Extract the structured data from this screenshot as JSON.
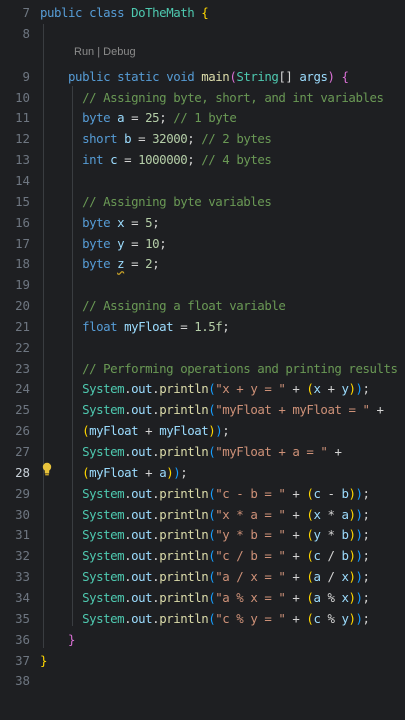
{
  "editor": {
    "language": "java",
    "active_line": 28,
    "codelens": "Run | Debug",
    "lines": [
      {
        "n": "7",
        "parts": [
          [
            "kw",
            "public "
          ],
          [
            "kw",
            "class "
          ],
          [
            "ty",
            "DoTheMath"
          ],
          [
            "pn",
            " "
          ],
          [
            "br1",
            "{"
          ]
        ]
      },
      {
        "n": "8",
        "parts": []
      },
      {
        "n": "9",
        "parts": [
          [
            "pn",
            "    "
          ],
          [
            "kw",
            "public "
          ],
          [
            "kw",
            "static "
          ],
          [
            "kw",
            "void "
          ],
          [
            "fn",
            "main"
          ],
          [
            "br2",
            "("
          ],
          [
            "ty",
            "String"
          ],
          [
            "pn",
            "[] "
          ],
          [
            "var",
            "args"
          ],
          [
            "br2",
            ")"
          ],
          [
            "pn",
            " "
          ],
          [
            "br2",
            "{"
          ]
        ]
      },
      {
        "n": "10",
        "parts": [
          [
            "pn",
            "      "
          ],
          [
            "cm",
            "// Assigning byte, short, and int variables"
          ]
        ]
      },
      {
        "n": "11",
        "parts": [
          [
            "pn",
            "      "
          ],
          [
            "kw",
            "byte "
          ],
          [
            "var",
            "a"
          ],
          [
            "pn",
            " = "
          ],
          [
            "num",
            "25"
          ],
          [
            "pn",
            "; "
          ],
          [
            "cm",
            "// 1 byte"
          ]
        ]
      },
      {
        "n": "12",
        "parts": [
          [
            "pn",
            "      "
          ],
          [
            "kw",
            "short "
          ],
          [
            "var",
            "b"
          ],
          [
            "pn",
            " = "
          ],
          [
            "num",
            "32000"
          ],
          [
            "pn",
            "; "
          ],
          [
            "cm",
            "// 2 bytes"
          ]
        ]
      },
      {
        "n": "13",
        "parts": [
          [
            "pn",
            "      "
          ],
          [
            "kw",
            "int "
          ],
          [
            "var",
            "c"
          ],
          [
            "pn",
            " = "
          ],
          [
            "num",
            "1000000"
          ],
          [
            "pn",
            "; "
          ],
          [
            "cm",
            "// 4 bytes"
          ]
        ]
      },
      {
        "n": "14",
        "parts": []
      },
      {
        "n": "15",
        "parts": [
          [
            "pn",
            "      "
          ],
          [
            "cm",
            "// Assigning byte variables"
          ]
        ]
      },
      {
        "n": "16",
        "parts": [
          [
            "pn",
            "      "
          ],
          [
            "kw",
            "byte "
          ],
          [
            "var",
            "x"
          ],
          [
            "pn",
            " = "
          ],
          [
            "num",
            "5"
          ],
          [
            "pn",
            ";"
          ]
        ]
      },
      {
        "n": "17",
        "parts": [
          [
            "pn",
            "      "
          ],
          [
            "kw",
            "byte "
          ],
          [
            "var",
            "y"
          ],
          [
            "pn",
            " = "
          ],
          [
            "num",
            "10"
          ],
          [
            "pn",
            ";"
          ]
        ]
      },
      {
        "n": "18",
        "parts": [
          [
            "pn",
            "      "
          ],
          [
            "kw",
            "byte "
          ],
          [
            "squig",
            "z"
          ],
          [
            "pn",
            " = "
          ],
          [
            "num",
            "2"
          ],
          [
            "pn",
            ";"
          ]
        ]
      },
      {
        "n": "19",
        "parts": []
      },
      {
        "n": "20",
        "parts": [
          [
            "pn",
            "      "
          ],
          [
            "cm",
            "// Assigning a float variable"
          ]
        ]
      },
      {
        "n": "21",
        "parts": [
          [
            "pn",
            "      "
          ],
          [
            "kw",
            "float "
          ],
          [
            "var",
            "myFloat"
          ],
          [
            "pn",
            " = "
          ],
          [
            "num",
            "1.5f"
          ],
          [
            "pn",
            ";"
          ]
        ]
      },
      {
        "n": "22",
        "parts": []
      },
      {
        "n": "23",
        "parts": [
          [
            "pn",
            "      "
          ],
          [
            "cm",
            "// Performing operations and printing results"
          ]
        ]
      },
      {
        "n": "24",
        "parts": [
          [
            "pn",
            "      "
          ],
          [
            "ty",
            "System"
          ],
          [
            "pn",
            "."
          ],
          [
            "var",
            "out"
          ],
          [
            "pn",
            "."
          ],
          [
            "fn",
            "println"
          ],
          [
            "br3",
            "("
          ],
          [
            "str",
            "\"x + y = \""
          ],
          [
            "pn",
            " + "
          ],
          [
            "br1",
            "("
          ],
          [
            "var",
            "x"
          ],
          [
            "pn",
            " + "
          ],
          [
            "var",
            "y"
          ],
          [
            "br1",
            ")"
          ],
          [
            "br3",
            ")"
          ],
          [
            "pn",
            ";"
          ]
        ]
      },
      {
        "n": "25",
        "parts": [
          [
            "pn",
            "      "
          ],
          [
            "ty",
            "System"
          ],
          [
            "pn",
            "."
          ],
          [
            "var",
            "out"
          ],
          [
            "pn",
            "."
          ],
          [
            "fn",
            "println"
          ],
          [
            "br3",
            "("
          ],
          [
            "str",
            "\"myFloat + myFloat = \""
          ],
          [
            "pn",
            " +"
          ]
        ]
      },
      {
        "n": "26",
        "parts": [
          [
            "pn",
            "      "
          ],
          [
            "br1",
            "("
          ],
          [
            "var",
            "myFloat"
          ],
          [
            "pn",
            " + "
          ],
          [
            "var",
            "myFloat"
          ],
          [
            "br1",
            ")"
          ],
          [
            "br3",
            ")"
          ],
          [
            "pn",
            ";"
          ]
        ]
      },
      {
        "n": "27",
        "parts": [
          [
            "pn",
            "      "
          ],
          [
            "ty",
            "System"
          ],
          [
            "pn",
            "."
          ],
          [
            "var",
            "out"
          ],
          [
            "pn",
            "."
          ],
          [
            "fn",
            "println"
          ],
          [
            "br3",
            "("
          ],
          [
            "str",
            "\"myFloat + a = \""
          ],
          [
            "pn",
            " +"
          ]
        ]
      },
      {
        "n": "28",
        "parts": [
          [
            "pn",
            "      "
          ],
          [
            "br1",
            "("
          ],
          [
            "var",
            "myFloat"
          ],
          [
            "pn",
            " + "
          ],
          [
            "var",
            "a"
          ],
          [
            "br1",
            ")"
          ],
          [
            "br3",
            ")"
          ],
          [
            "pn",
            ";"
          ]
        ]
      },
      {
        "n": "29",
        "parts": [
          [
            "pn",
            "      "
          ],
          [
            "ty",
            "System"
          ],
          [
            "pn",
            "."
          ],
          [
            "var",
            "out"
          ],
          [
            "pn",
            "."
          ],
          [
            "fn",
            "println"
          ],
          [
            "br3",
            "("
          ],
          [
            "str",
            "\"c - b = \""
          ],
          [
            "pn",
            " + "
          ],
          [
            "br1",
            "("
          ],
          [
            "var",
            "c"
          ],
          [
            "pn",
            " - "
          ],
          [
            "var",
            "b"
          ],
          [
            "br1",
            ")"
          ],
          [
            "br3",
            ")"
          ],
          [
            "pn",
            ";"
          ]
        ]
      },
      {
        "n": "30",
        "parts": [
          [
            "pn",
            "      "
          ],
          [
            "ty",
            "System"
          ],
          [
            "pn",
            "."
          ],
          [
            "var",
            "out"
          ],
          [
            "pn",
            "."
          ],
          [
            "fn",
            "println"
          ],
          [
            "br3",
            "("
          ],
          [
            "str",
            "\"x * a = \""
          ],
          [
            "pn",
            " + "
          ],
          [
            "br1",
            "("
          ],
          [
            "var",
            "x"
          ],
          [
            "pn",
            " * "
          ],
          [
            "var",
            "a"
          ],
          [
            "br1",
            ")"
          ],
          [
            "br3",
            ")"
          ],
          [
            "pn",
            ";"
          ]
        ]
      },
      {
        "n": "31",
        "parts": [
          [
            "pn",
            "      "
          ],
          [
            "ty",
            "System"
          ],
          [
            "pn",
            "."
          ],
          [
            "var",
            "out"
          ],
          [
            "pn",
            "."
          ],
          [
            "fn",
            "println"
          ],
          [
            "br3",
            "("
          ],
          [
            "str",
            "\"y * b = \""
          ],
          [
            "pn",
            " + "
          ],
          [
            "br1",
            "("
          ],
          [
            "var",
            "y"
          ],
          [
            "pn",
            " * "
          ],
          [
            "var",
            "b"
          ],
          [
            "br1",
            ")"
          ],
          [
            "br3",
            ")"
          ],
          [
            "pn",
            ";"
          ]
        ]
      },
      {
        "n": "32",
        "parts": [
          [
            "pn",
            "      "
          ],
          [
            "ty",
            "System"
          ],
          [
            "pn",
            "."
          ],
          [
            "var",
            "out"
          ],
          [
            "pn",
            "."
          ],
          [
            "fn",
            "println"
          ],
          [
            "br3",
            "("
          ],
          [
            "str",
            "\"c / b = \""
          ],
          [
            "pn",
            " + "
          ],
          [
            "br1",
            "("
          ],
          [
            "var",
            "c"
          ],
          [
            "pn",
            " / "
          ],
          [
            "var",
            "b"
          ],
          [
            "br1",
            ")"
          ],
          [
            "br3",
            ")"
          ],
          [
            "pn",
            ";"
          ]
        ]
      },
      {
        "n": "33",
        "parts": [
          [
            "pn",
            "      "
          ],
          [
            "ty",
            "System"
          ],
          [
            "pn",
            "."
          ],
          [
            "var",
            "out"
          ],
          [
            "pn",
            "."
          ],
          [
            "fn",
            "println"
          ],
          [
            "br3",
            "("
          ],
          [
            "str",
            "\"a / x = \""
          ],
          [
            "pn",
            " + "
          ],
          [
            "br1",
            "("
          ],
          [
            "var",
            "a"
          ],
          [
            "pn",
            " / "
          ],
          [
            "var",
            "x"
          ],
          [
            "br1",
            ")"
          ],
          [
            "br3",
            ")"
          ],
          [
            "pn",
            ";"
          ]
        ]
      },
      {
        "n": "34",
        "parts": [
          [
            "pn",
            "      "
          ],
          [
            "ty",
            "System"
          ],
          [
            "pn",
            "."
          ],
          [
            "var",
            "out"
          ],
          [
            "pn",
            "."
          ],
          [
            "fn",
            "println"
          ],
          [
            "br3",
            "("
          ],
          [
            "str",
            "\"a % x = \""
          ],
          [
            "pn",
            " + "
          ],
          [
            "br1",
            "("
          ],
          [
            "var",
            "a"
          ],
          [
            "pn",
            " % "
          ],
          [
            "var",
            "x"
          ],
          [
            "br1",
            ")"
          ],
          [
            "br3",
            ")"
          ],
          [
            "pn",
            ";"
          ]
        ]
      },
      {
        "n": "35",
        "parts": [
          [
            "pn",
            "      "
          ],
          [
            "ty",
            "System"
          ],
          [
            "pn",
            "."
          ],
          [
            "var",
            "out"
          ],
          [
            "pn",
            "."
          ],
          [
            "fn",
            "println"
          ],
          [
            "br3",
            "("
          ],
          [
            "str",
            "\"c % y = \""
          ],
          [
            "pn",
            " + "
          ],
          [
            "br1",
            "("
          ],
          [
            "var",
            "c"
          ],
          [
            "pn",
            " % "
          ],
          [
            "var",
            "y"
          ],
          [
            "br1",
            ")"
          ],
          [
            "br3",
            ")"
          ],
          [
            "pn",
            ";"
          ]
        ]
      },
      {
        "n": "36",
        "parts": [
          [
            "pn",
            "    "
          ],
          [
            "br2",
            "}"
          ]
        ]
      },
      {
        "n": "37",
        "parts": [
          [
            "br1",
            "}"
          ]
        ]
      },
      {
        "n": "38",
        "parts": []
      }
    ]
  }
}
